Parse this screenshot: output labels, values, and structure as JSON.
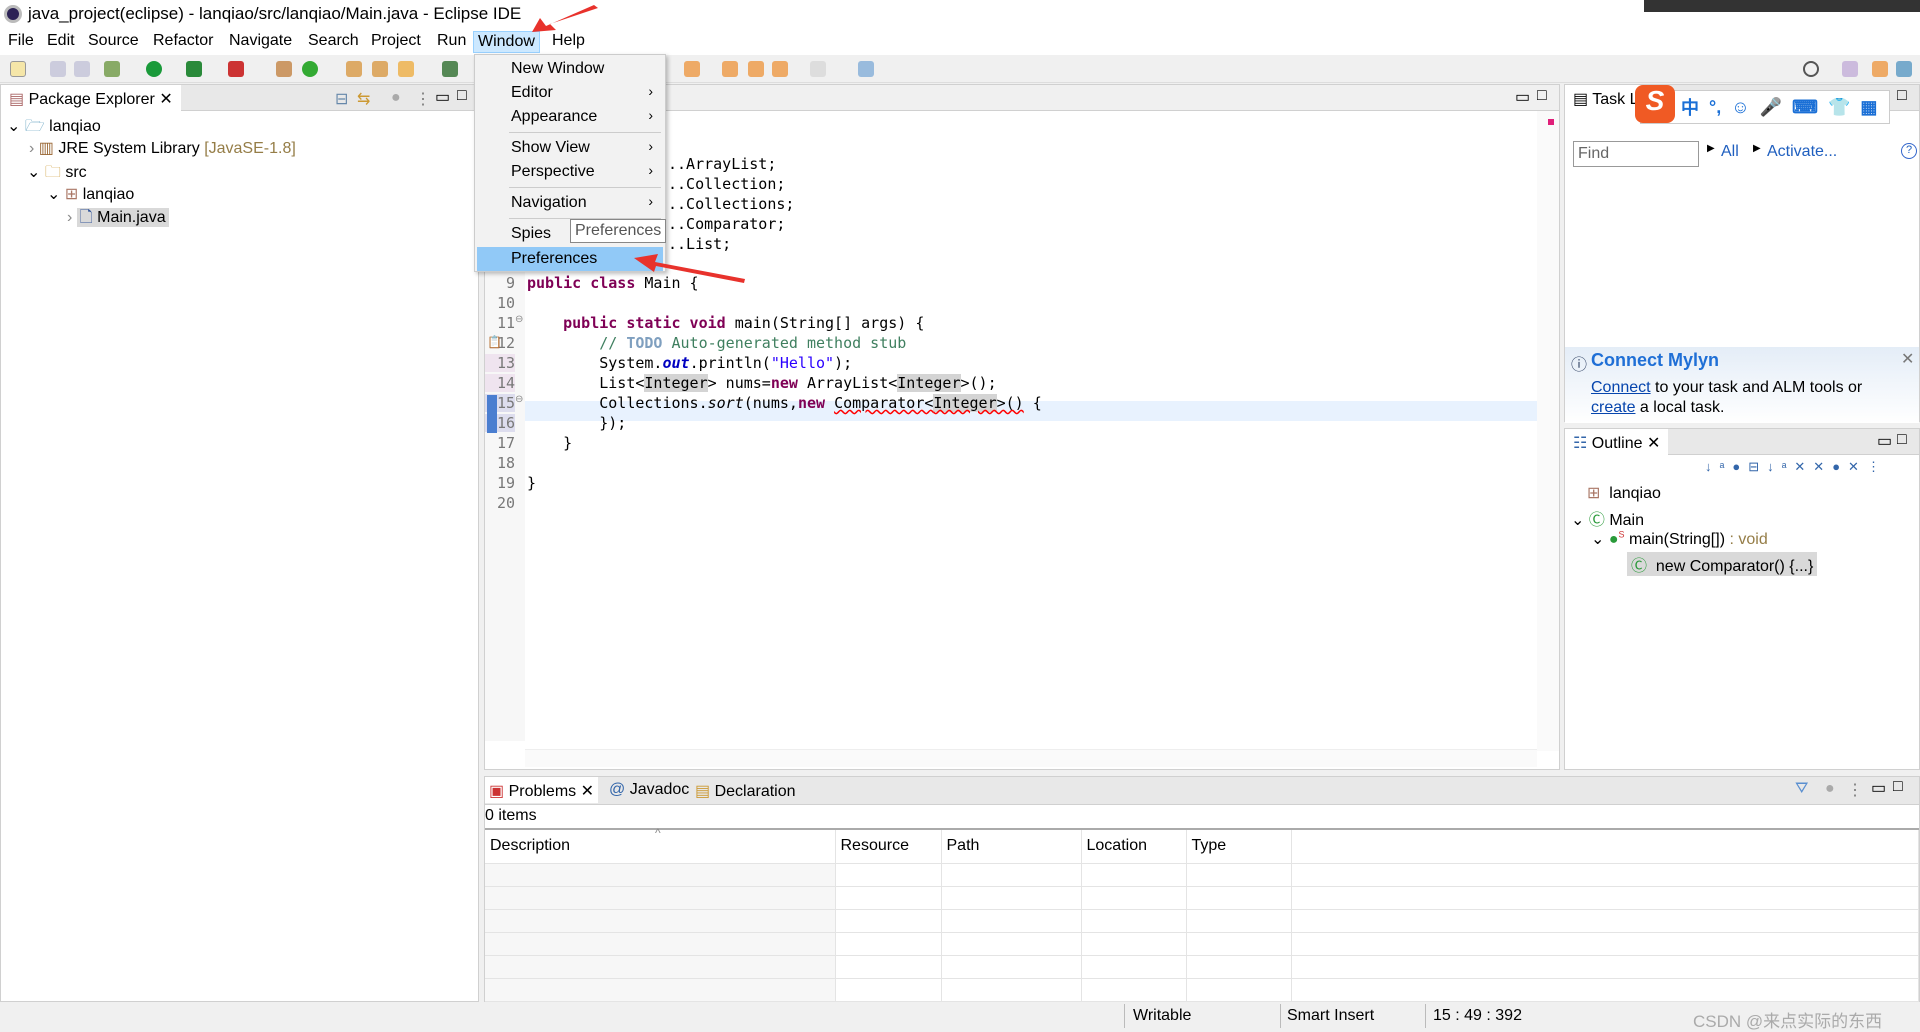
{
  "window": {
    "title": "java_project(eclipse) - lanqiao/src/lanqiao/Main.java - Eclipse IDE"
  },
  "menubar": [
    "File",
    "Edit",
    "Source",
    "Refactor",
    "Navigate",
    "Search",
    "Project",
    "Run",
    "Window",
    "Help"
  ],
  "window_menu": {
    "items": [
      {
        "label": "New Window",
        "submenu": false
      },
      {
        "label": "Editor",
        "submenu": true
      },
      {
        "label": "Appearance",
        "submenu": true
      },
      {
        "label": "Show View",
        "submenu": true
      },
      {
        "label": "Perspective",
        "submenu": true
      },
      {
        "label": "Navigation",
        "submenu": true
      },
      {
        "label": "Spies",
        "submenu": false
      },
      {
        "label": "Preferences",
        "submenu": false,
        "highlighted": true
      }
    ],
    "tooltip": "Preferences",
    "arrow_glyph": "›"
  },
  "package_explorer": {
    "tab": "Package Explorer",
    "tree": [
      {
        "label": "lanqiao",
        "icon": "project-icon",
        "expanded": true
      },
      {
        "label": "JRE System Library",
        "suffix": "[JavaSE-1.8]",
        "icon": "library-icon"
      },
      {
        "label": "src",
        "icon": "source-folder-icon",
        "expanded": true
      },
      {
        "label": "lanqiao",
        "icon": "package-icon",
        "expanded": true
      },
      {
        "label": "Main.java",
        "icon": "java-file-icon",
        "selected": true
      }
    ]
  },
  "editor": {
    "import_fragments": [
      "..ArrayList;",
      "..Collection;",
      "..Collections;",
      "..Comparator;",
      "..List;"
    ],
    "line_numbers": [
      "9",
      "10",
      "11",
      "12",
      "13",
      "14",
      "15",
      "16",
      "17",
      "18",
      "19",
      "20"
    ],
    "code": {
      "l9a": "public class",
      "l9b": " Main {",
      "l11a": "    public static void",
      "l11b": " main(String[] args) {",
      "l12a": "        // ",
      "l12b": "TODO",
      "l12c": " Auto-generated method stub",
      "l13a": "        System.",
      "l13b": "out",
      "l13c": ".println(",
      "l13d": "\"Hello\"",
      "l13e": ");",
      "l14a": "        List<",
      "l14b": "Integer",
      "l14c": "> nums=",
      "l14d": "new",
      "l14e": " ArrayList<",
      "l14f": "Integer",
      "l14g": ">();",
      "l15a": "        Collections.",
      "l15b": "sort",
      "l15c": "(nums,",
      "l15d": "new",
      "l15e": " ",
      "l15f": "Comparator<",
      "l15g": "Integer",
      "l15h": ">()",
      " l15i": "",
      "l15j": " {",
      "l16": "        });",
      "l17": "    }",
      "l19": "}"
    }
  },
  "task_list": {
    "tab": "Task Li",
    "find_placeholder": "Find",
    "all": "All",
    "activate": "Activate...",
    "help": "?"
  },
  "ime_toolbar": {
    "logo": "S",
    "items": [
      "中",
      "°,",
      "☺",
      "🎤",
      "⌨",
      "👕",
      "▦"
    ]
  },
  "mylyn": {
    "title": "Connect Mylyn",
    "connect": "Connect",
    "text1": " to your task and ALM tools or",
    "create": "create",
    "text2": " a local task."
  },
  "outline": {
    "tab": "Outline",
    "tree": [
      {
        "label": "lanqiao"
      },
      {
        "label": "Main"
      },
      {
        "label": "main(String[])",
        "type": " : void",
        "modifier": "S"
      },
      {
        "label": "new Comparator() {...}",
        "selected": true
      }
    ]
  },
  "problems": {
    "tabs": [
      "Problems",
      "Javadoc",
      "Declaration"
    ],
    "count": "0 items",
    "columns": [
      "Description",
      "Resource",
      "Path",
      "Location",
      "Type"
    ],
    "sort_indicator": "^"
  },
  "statusbar": {
    "writable": "Writable",
    "insert_mode": "Smart Insert",
    "position": "15 : 49 : 392"
  },
  "watermark": "CSDN @来点实际的东西",
  "colors": {
    "accent": "#91c9f7",
    "annotation_arrow": "#e8322c",
    "link": "#0645ad"
  }
}
